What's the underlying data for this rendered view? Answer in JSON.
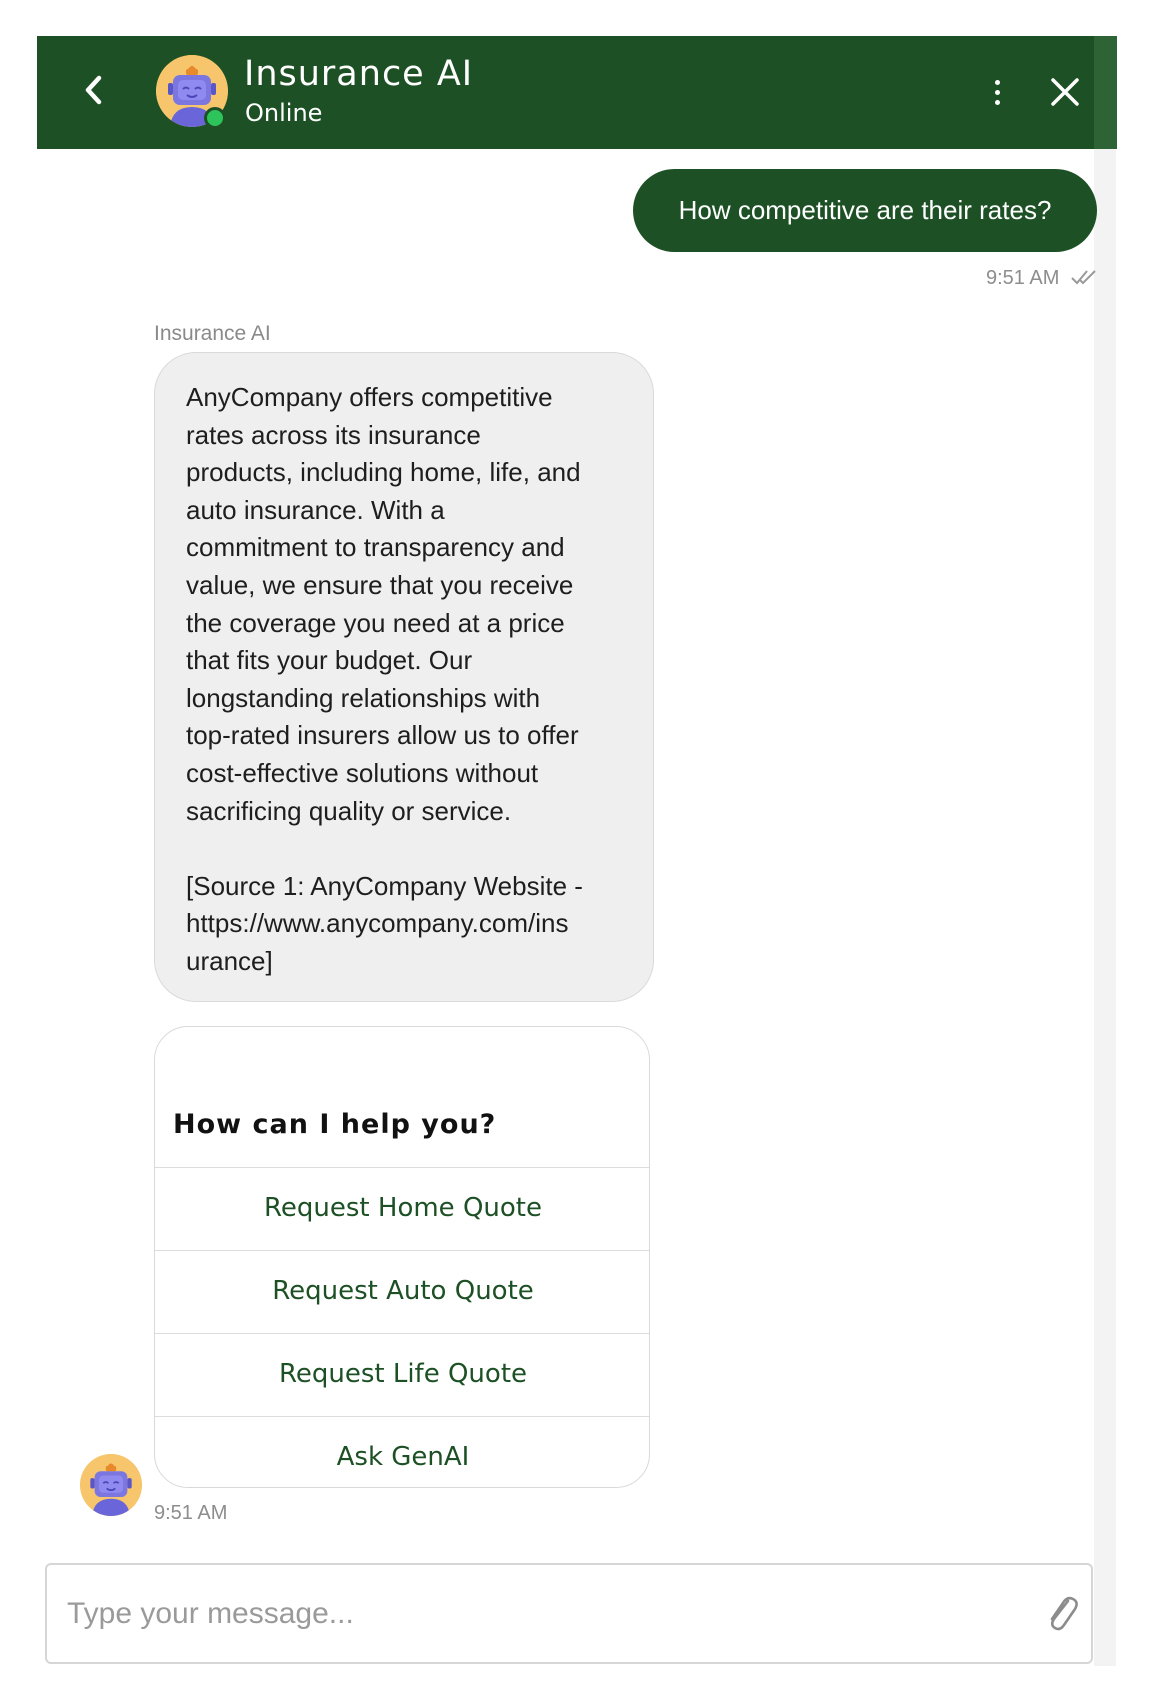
{
  "header": {
    "title": "Insurance AI",
    "status": "Online",
    "back_icon": "chevron-left-icon",
    "menu_icon": "kebab-menu-icon",
    "close_icon": "close-icon"
  },
  "colors": {
    "brand": "#1d5125",
    "online": "#2ec45c",
    "bot_bubble": "#efefef",
    "avatar_bg": "#f6c56c"
  },
  "messages": {
    "user": {
      "text": "How competitive are their rates?",
      "time": "9:51 AM",
      "status_icon": "double-check-icon"
    },
    "bot": {
      "sender": "Insurance AI",
      "text": "AnyCompany offers competitive\nrates across its insurance\nproducts, including home, life, and\nauto insurance. With a\ncommitment to transparency and\nvalue, we ensure that you receive\nthe coverage you need at a price\nthat fits your budget. Our\nlongstanding relationships with\ntop-rated insurers allow us to offer\ncost-effective solutions without\nsacrificing quality or service.\n\n[Source 1: AnyCompany Website -\nhttps://www.anycompany.com/ins\nurance]"
    },
    "card": {
      "title": "How can I help you?",
      "options": [
        "Request Home Quote",
        "Request Auto Quote",
        "Request Life Quote",
        "Ask GenAI"
      ],
      "time": "9:51 AM"
    }
  },
  "composer": {
    "placeholder": "Type your message...",
    "attach_icon": "paperclip-icon"
  }
}
